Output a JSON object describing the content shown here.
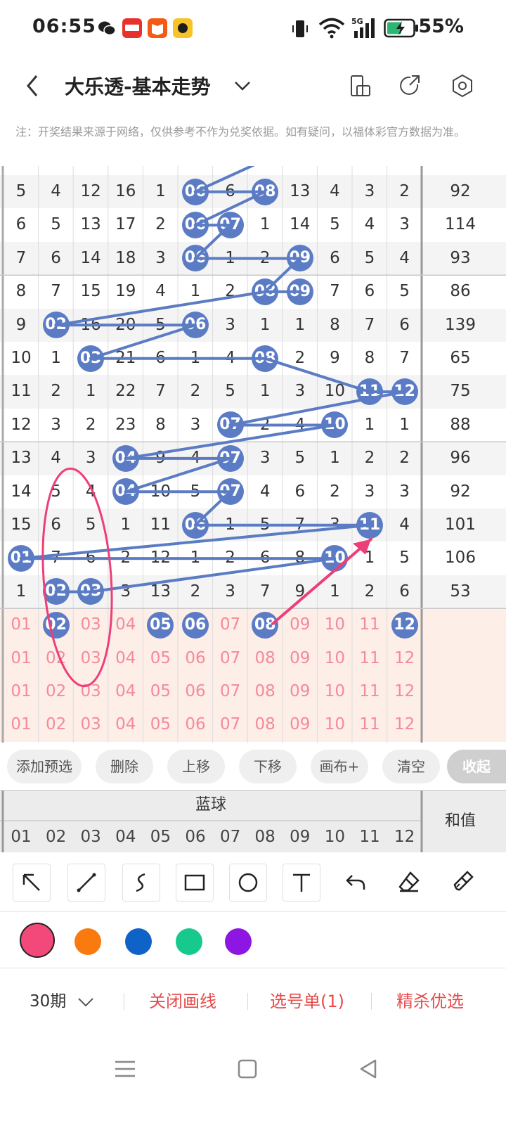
{
  "status": {
    "time": "06:55",
    "battery": "55%"
  },
  "app": {
    "title": "大乐透-基本走势"
  },
  "note": "注：开奖结果来源于网络，仅供参考不作为兑奖依据。如有疑问，以福体彩官方数据为准。",
  "grid": {
    "rows": [
      {
        "cells": [
          "5",
          "4",
          "12",
          "16",
          "1",
          "06",
          "6",
          "08",
          "13",
          "4",
          "3",
          "2"
        ],
        "sum": "92"
      },
      {
        "cells": [
          "6",
          "5",
          "13",
          "17",
          "2",
          "06",
          "07",
          "1",
          "14",
          "5",
          "4",
          "3"
        ],
        "sum": "114"
      },
      {
        "cells": [
          "7",
          "6",
          "14",
          "18",
          "3",
          "06",
          "1",
          "2",
          "09",
          "6",
          "5",
          "4"
        ],
        "sum": "93"
      },
      {
        "cells": [
          "8",
          "7",
          "15",
          "19",
          "4",
          "1",
          "2",
          "08",
          "09",
          "7",
          "6",
          "5"
        ],
        "sum": "86"
      },
      {
        "cells": [
          "9",
          "02",
          "16",
          "20",
          "5",
          "06",
          "3",
          "1",
          "1",
          "8",
          "7",
          "6"
        ],
        "sum": "139"
      },
      {
        "cells": [
          "10",
          "1",
          "03",
          "21",
          "6",
          "1",
          "4",
          "08",
          "2",
          "9",
          "8",
          "7"
        ],
        "sum": "65"
      },
      {
        "cells": [
          "11",
          "2",
          "1",
          "22",
          "7",
          "2",
          "5",
          "1",
          "3",
          "10",
          "11",
          "12"
        ],
        "sum": "75"
      },
      {
        "cells": [
          "12",
          "3",
          "2",
          "23",
          "8",
          "3",
          "07",
          "2",
          "4",
          "10",
          "1",
          "1"
        ],
        "sum": "88"
      },
      {
        "cells": [
          "13",
          "4",
          "3",
          "04",
          "9",
          "4",
          "07",
          "3",
          "5",
          "1",
          "2",
          "2"
        ],
        "sum": "96"
      },
      {
        "cells": [
          "14",
          "5",
          "4",
          "04",
          "10",
          "5",
          "07",
          "4",
          "6",
          "2",
          "3",
          "3"
        ],
        "sum": "92"
      },
      {
        "cells": [
          "15",
          "6",
          "5",
          "1",
          "11",
          "06",
          "1",
          "5",
          "7",
          "3",
          "11",
          "4"
        ],
        "sum": "101"
      },
      {
        "cells": [
          "01",
          "7",
          "6",
          "2",
          "12",
          "1",
          "2",
          "6",
          "8",
          "10",
          "1",
          "5"
        ],
        "sum": "106"
      },
      {
        "cells": [
          "1",
          "02",
          "03",
          "3",
          "13",
          "2",
          "3",
          "7",
          "9",
          "1",
          "2",
          "6"
        ],
        "sum": "53"
      }
    ],
    "pick_rows": [
      [
        "01",
        "02",
        "03",
        "04",
        "05",
        "06",
        "07",
        "08",
        "09",
        "10",
        "11",
        "12"
      ],
      [
        "01",
        "02",
        "03",
        "04",
        "05",
        "06",
        "07",
        "08",
        "09",
        "10",
        "11",
        "12"
      ],
      [
        "01",
        "02",
        "03",
        "04",
        "05",
        "06",
        "07",
        "08",
        "09",
        "10",
        "11",
        "12"
      ],
      [
        "01",
        "02",
        "03",
        "04",
        "05",
        "06",
        "07",
        "08",
        "09",
        "10",
        "11",
        "12"
      ]
    ]
  },
  "toolbar": {
    "add_preselect": "添加预选",
    "delete": "删除",
    "move_up": "上移",
    "move_down": "下移",
    "canvas_plus": "画布+",
    "clear": "清空",
    "collapse": "收起"
  },
  "header": {
    "blue_ball": "蓝球",
    "sum": "和值",
    "numbers": [
      "01",
      "02",
      "03",
      "04",
      "05",
      "06",
      "07",
      "08",
      "09",
      "10",
      "11",
      "12"
    ]
  },
  "palette": {
    "colors": [
      "#f2487a",
      "#f97a0e",
      "#0f62c7",
      "#18c98e",
      "#8e16e3"
    ]
  },
  "footer": {
    "period": "30期",
    "close_lines": "关闭画线",
    "pick_list": "选号单(1)",
    "elite": "精杀优选"
  }
}
